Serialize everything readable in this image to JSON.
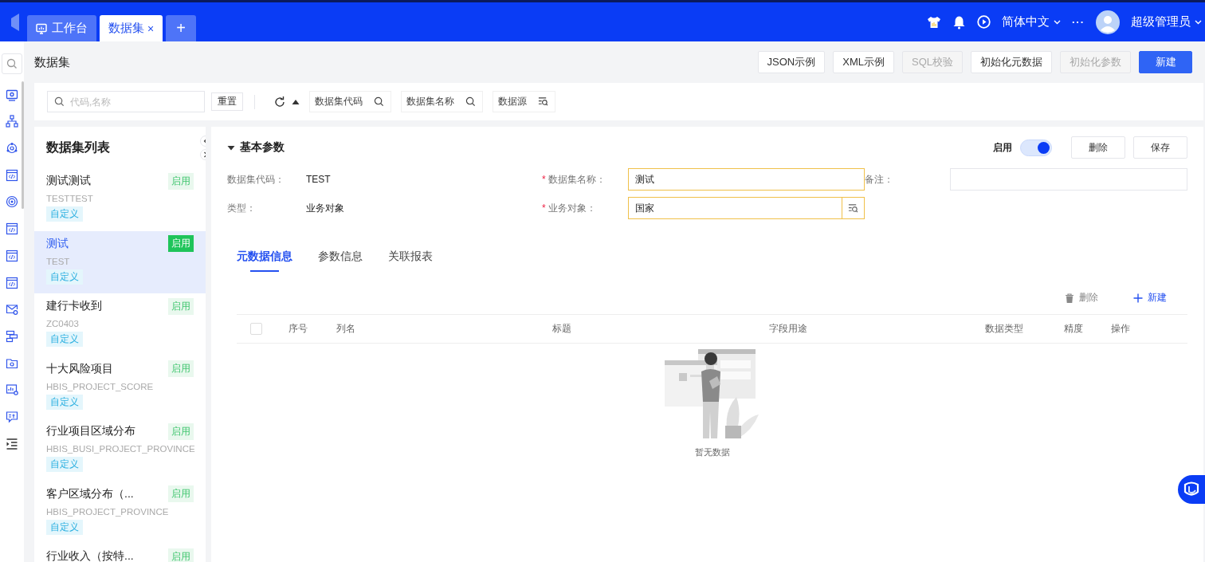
{
  "top_bar": {
    "tabs": [
      {
        "label": "工作台",
        "selected": false,
        "closable": false
      },
      {
        "label": "数据集",
        "selected": true,
        "closable": true
      }
    ],
    "close": "×",
    "add_tab": "+",
    "language": "简体中文",
    "more": "···",
    "user": "超级管理员"
  },
  "page": {
    "title": "数据集",
    "actions": [
      {
        "label": "JSON示例",
        "disabled": false,
        "primary": false
      },
      {
        "label": "XML示例",
        "disabled": false,
        "primary": false
      },
      {
        "label": "SQL校验",
        "disabled": true,
        "primary": false
      },
      {
        "label": "初始化元数据",
        "disabled": false,
        "primary": false
      },
      {
        "label": "初始化参数",
        "disabled": true,
        "primary": false
      },
      {
        "label": "新建",
        "disabled": false,
        "primary": true
      }
    ]
  },
  "filters": {
    "search_placeholder": "代码,名称",
    "reset": "重置",
    "sort_ascending": true,
    "columns": [
      {
        "label": "数据集代码",
        "kind": "search"
      },
      {
        "label": "数据集名称",
        "kind": "search"
      },
      {
        "label": "数据源",
        "kind": "lookup"
      }
    ]
  },
  "dataset_list": {
    "title": "数据集列表",
    "items": [
      {
        "name": "测试测试",
        "code": "TESTTEST",
        "tag": "自定义",
        "status": "启用",
        "selected": false
      },
      {
        "name": "测试",
        "code": "TEST",
        "tag": "自定义",
        "status": "启用",
        "selected": true
      },
      {
        "name": "建行卡收到",
        "code": "ZC0403",
        "tag": "自定义",
        "status": "启用",
        "selected": false
      },
      {
        "name": "十大风险项目",
        "code": "HBIS_PROJECT_SCORE",
        "tag": "自定义",
        "status": "启用",
        "selected": false
      },
      {
        "name": "行业项目区域分布",
        "code": "HBIS_BUSI_PROJECT_PROVINCE",
        "tag": "自定义",
        "status": "启用",
        "selected": false
      },
      {
        "name": "客户区域分布（...",
        "code": "HBIS_PROJECT_PROVINCE",
        "tag": "自定义",
        "status": "启用",
        "selected": false
      },
      {
        "name": "行业收入（按特...",
        "status": "启用",
        "selected": false
      }
    ]
  },
  "detail": {
    "section_title": "基本参数",
    "required_mark": "*",
    "expanded": true,
    "enable_label": "启用",
    "enabled": true,
    "buttons": [
      "删除",
      "保存"
    ],
    "fields": [
      {
        "label": "数据集代码：",
        "value": "TEST",
        "kind": "text",
        "required": false
      },
      {
        "label": "数据集名称：",
        "value": "测试",
        "kind": "input",
        "required": true
      },
      {
        "label": "备注：",
        "kind": "input",
        "required": false
      },
      {
        "label": "类型：",
        "value": "业务对象",
        "kind": "text",
        "required": false
      },
      {
        "label": "业务对象：",
        "value": "国家",
        "kind": "lookup",
        "required": true
      }
    ],
    "tabs": [
      {
        "label": "元数据信息",
        "selected": true
      },
      {
        "label": "参数信息",
        "selected": false
      },
      {
        "label": "关联报表",
        "selected": false
      }
    ],
    "table": {
      "actions": [
        {
          "label": "删除",
          "kind": "delete",
          "disabled": true
        },
        {
          "label": "新建",
          "kind": "add",
          "disabled": false
        }
      ],
      "select_all_checked": false,
      "columns": [
        "序号",
        "列名",
        "标题",
        "字段用途",
        "数据类型",
        "精度",
        "操作"
      ],
      "empty_text": "暂无数据"
    }
  }
}
